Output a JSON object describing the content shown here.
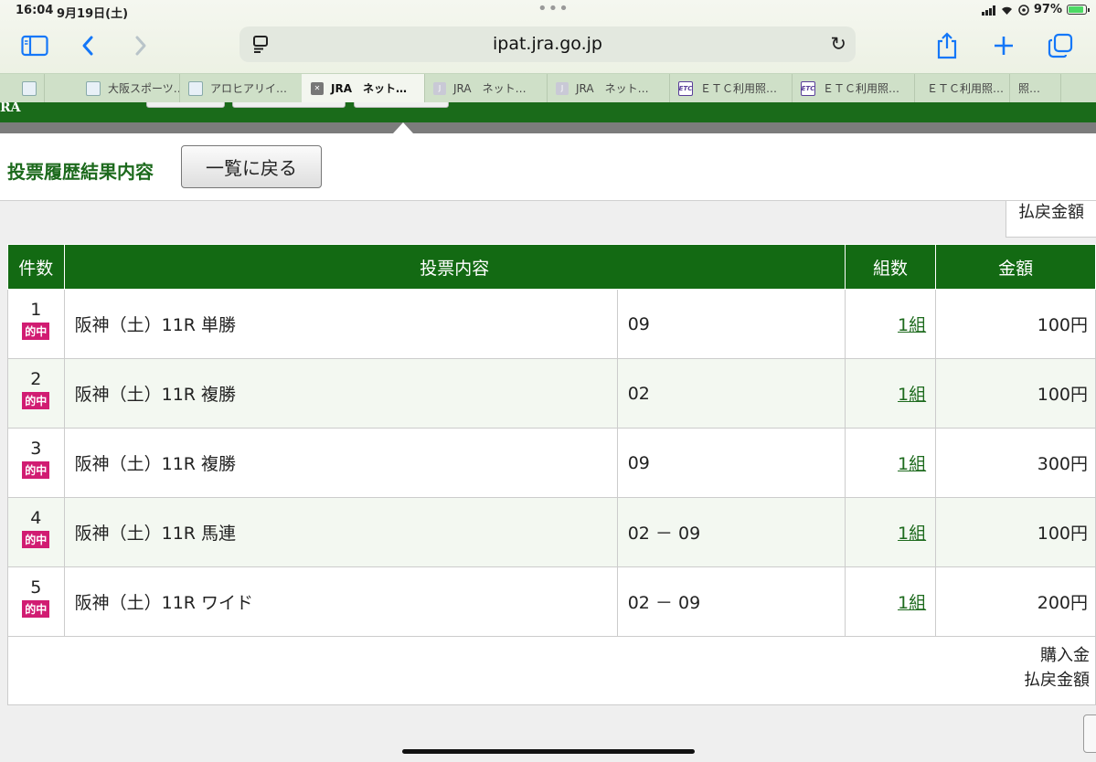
{
  "status": {
    "time": "16:04",
    "date": "9月19日(土)",
    "battery": "97%"
  },
  "browser": {
    "url": "ipat.jra.go.jp",
    "tabs": [
      {
        "label": "",
        "favicon": "sports"
      },
      {
        "label": "大阪スポーツ…",
        "favicon": "sports"
      },
      {
        "label": "アロヒアリイ…",
        "favicon": "sports"
      },
      {
        "label": "JRA　ネット…",
        "favicon": "close",
        "active": true
      },
      {
        "label": "JRA　ネット…",
        "favicon": "j"
      },
      {
        "label": "JRA　ネット…",
        "favicon": "j"
      },
      {
        "label": "ＥＴＣ利用照…",
        "favicon": "etc"
      },
      {
        "label": "ＥＴＣ利用照…",
        "favicon": "etc"
      },
      {
        "label": "ＥＴＣ利用照…",
        "favicon": "etc"
      },
      {
        "label": "照…",
        "favicon": "none"
      }
    ]
  },
  "page": {
    "logo": "RA",
    "title": "投票履歴結果内容",
    "back_button": "一覧に戻る",
    "payout_label": "払戻金額"
  },
  "table": {
    "headers": {
      "no": "件数",
      "content": "投票内容",
      "count": "組数",
      "amount": "金額"
    },
    "rows": [
      {
        "no": "1",
        "badge": "的中",
        "desc": "阪神（土）11R 単勝",
        "selection": "09",
        "count": "1組",
        "amount": "100円"
      },
      {
        "no": "2",
        "badge": "的中",
        "desc": "阪神（土）11R 複勝",
        "selection": "02",
        "count": "1組",
        "amount": "100円"
      },
      {
        "no": "3",
        "badge": "的中",
        "desc": "阪神（土）11R 複勝",
        "selection": "09",
        "count": "1組",
        "amount": "300円"
      },
      {
        "no": "4",
        "badge": "的中",
        "desc": "阪神（土）11R 馬連",
        "selection": "02 － 09",
        "count": "1組",
        "amount": "100円"
      },
      {
        "no": "5",
        "badge": "的中",
        "desc": "阪神（土）11R ワイド",
        "selection": "02 － 09",
        "count": "1組",
        "amount": "200円"
      }
    ],
    "summary": {
      "purchase_label": "購入金",
      "payout_label": "払戻金額"
    }
  },
  "colors": {
    "brand_green": "#136a13",
    "hit_badge": "#d11c72",
    "safari_blue": "#1477f8"
  }
}
